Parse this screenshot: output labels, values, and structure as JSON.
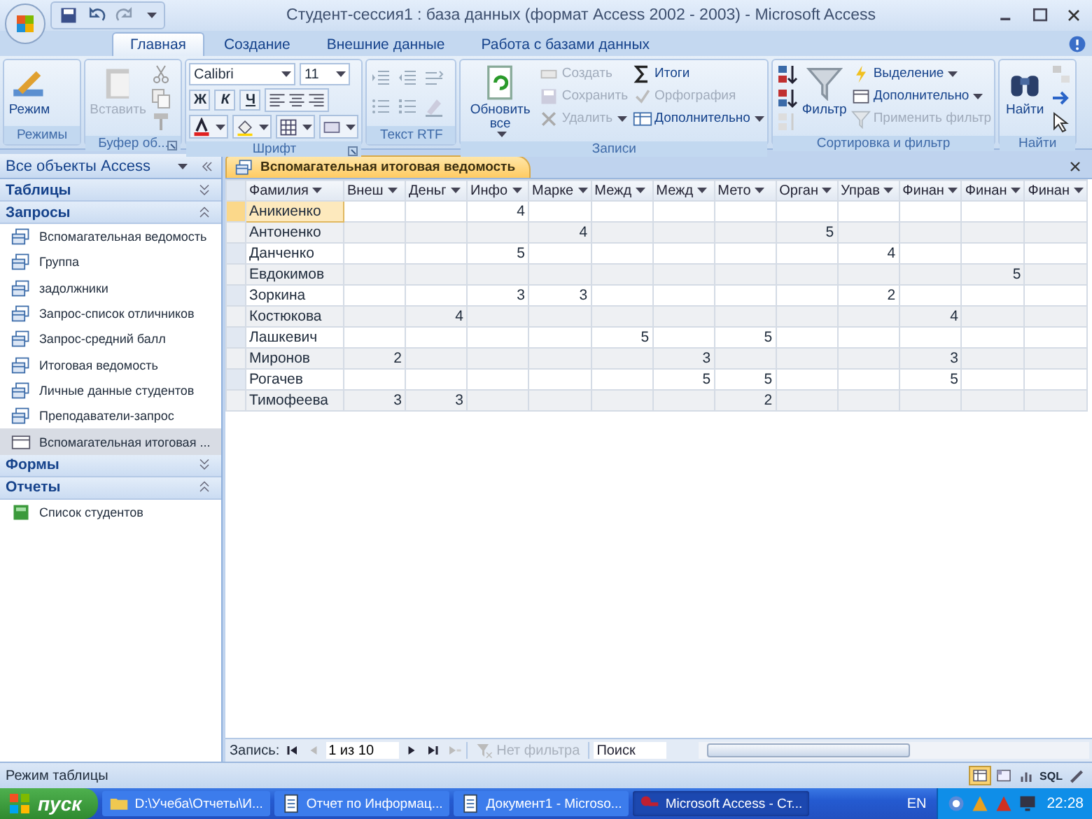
{
  "window": {
    "title": "Студент-сессия1 : база данных (формат Access 2002 - 2003) - Microsoft Access"
  },
  "ribbon_tabs": [
    {
      "label": "Главная",
      "selected": true
    },
    {
      "label": "Создание",
      "selected": false
    },
    {
      "label": "Внешние данные",
      "selected": false
    },
    {
      "label": "Работа с базами данных",
      "selected": false
    }
  ],
  "ribbon": [
    {
      "label": "Режимы",
      "launcher": false,
      "kind": "buttons",
      "large": [
        {
          "label": "Режим",
          "disabled": false,
          "dropdown": false
        }
      ]
    },
    {
      "label": "Буфер об...",
      "launcher": true,
      "kind": "buttons",
      "large": [
        {
          "label": "Вставить",
          "disabled": true,
          "dropdown": false
        }
      ]
    },
    {
      "label": "Шрифт",
      "launcher": true,
      "kind": "font",
      "font": "Calibri",
      "size": "11",
      "format_buttons": [
        "Ж",
        "К",
        "Ч"
      ]
    },
    {
      "label": "Текст RTF",
      "launcher": false,
      "kind": "buttons"
    },
    {
      "label": "Записи",
      "launcher": false,
      "kind": "buttons",
      "large": [
        {
          "label": "Обновить все",
          "disabled": false,
          "dropdown": true
        }
      ],
      "small": [
        {
          "label": "Создать",
          "disabled": true,
          "dropdown": false
        },
        {
          "label": "Сохранить",
          "disabled": true,
          "dropdown": false
        },
        {
          "label": "Удалить",
          "disabled": true,
          "dropdown": true
        },
        {
          "label": "Итоги",
          "disabled": false,
          "dropdown": false
        },
        {
          "label": "Орфография",
          "disabled": true,
          "dropdown": false
        },
        {
          "label": "Дополнительно",
          "disabled": false,
          "dropdown": true
        }
      ]
    },
    {
      "label": "Сортировка и фильтр",
      "launcher": false,
      "kind": "buttons",
      "large": [
        {
          "label": "Фильтр",
          "disabled": false,
          "dropdown": false
        }
      ],
      "small": [
        {
          "label": "Выделение",
          "disabled": false,
          "dropdown": true
        },
        {
          "label": "Дополнительно",
          "disabled": false,
          "dropdown": true
        },
        {
          "label": "Применить фильтр",
          "disabled": true,
          "dropdown": false
        }
      ]
    },
    {
      "label": "Найти",
      "launcher": false,
      "kind": "buttons",
      "large": [
        {
          "label": "Найти",
          "disabled": false,
          "dropdown": false
        }
      ]
    }
  ],
  "navigation_pane": {
    "title": "Все объекты Access",
    "sections": [
      {
        "label": "Таблицы",
        "expanded": false
      },
      {
        "label": "Запросы",
        "expanded": true,
        "items": [
          {
            "label": "Вспомагательная ведомость",
            "kind": "query",
            "selected": false
          },
          {
            "label": "Группа",
            "kind": "query",
            "selected": false
          },
          {
            "label": "задолжники",
            "kind": "query",
            "selected": false
          },
          {
            "label": "Запрос-список отличников",
            "kind": "query",
            "selected": false
          },
          {
            "label": "Запрос-средний балл",
            "kind": "query",
            "selected": false
          },
          {
            "label": "Итоговая ведомость",
            "kind": "query",
            "selected": false
          },
          {
            "label": "Личные данные студентов",
            "kind": "query",
            "selected": false
          },
          {
            "label": "Преподаватели-запрос",
            "kind": "query",
            "selected": false
          },
          {
            "label": "Вспомагательная итоговая ...",
            "kind": "datasheet",
            "selected": true
          }
        ]
      },
      {
        "label": "Формы",
        "expanded": false
      },
      {
        "label": "Отчеты",
        "expanded": true,
        "items": [
          {
            "label": "Список студентов",
            "kind": "report",
            "selected": false
          }
        ]
      }
    ]
  },
  "document_tab": {
    "title": "Вспомагательная итоговая ведомость"
  },
  "datasheet": {
    "columns": [
      "Фамилия",
      "Внеш",
      "Деньг",
      "Инфо",
      "Марке",
      "Межд",
      "Межд",
      "Мето",
      "Орган",
      "Управ",
      "Финан",
      "Финан",
      "Финан"
    ],
    "rows": [
      {
        "selected": true,
        "cells": [
          "Аникиенко",
          null,
          null,
          "4",
          null,
          null,
          null,
          null,
          null,
          null,
          null,
          null,
          null
        ]
      },
      {
        "selected": false,
        "cells": [
          "Антоненко",
          null,
          null,
          null,
          "4",
          null,
          null,
          null,
          "5",
          null,
          null,
          null,
          null
        ]
      },
      {
        "selected": false,
        "cells": [
          "Данченко",
          null,
          null,
          "5",
          null,
          null,
          null,
          null,
          null,
          "4",
          null,
          null,
          null
        ]
      },
      {
        "selected": false,
        "cells": [
          "Евдокимов",
          null,
          null,
          null,
          null,
          null,
          null,
          null,
          null,
          null,
          null,
          "5",
          null
        ]
      },
      {
        "selected": false,
        "cells": [
          "Зоркина",
          null,
          null,
          "3",
          "3",
          null,
          null,
          null,
          null,
          "2",
          null,
          null,
          null
        ]
      },
      {
        "selected": false,
        "cells": [
          "Костюкова",
          null,
          "4",
          null,
          null,
          null,
          null,
          null,
          null,
          null,
          "4",
          null,
          null
        ]
      },
      {
        "selected": false,
        "cells": [
          "Лашкевич",
          null,
          null,
          null,
          null,
          "5",
          null,
          "5",
          null,
          null,
          null,
          null,
          null
        ]
      },
      {
        "selected": false,
        "cells": [
          "Миронов",
          "2",
          null,
          null,
          null,
          null,
          "3",
          null,
          null,
          null,
          "3",
          null,
          null
        ]
      },
      {
        "selected": false,
        "cells": [
          "Рогачев",
          null,
          null,
          null,
          null,
          null,
          "5",
          "5",
          null,
          null,
          "5",
          null,
          null
        ]
      },
      {
        "selected": false,
        "cells": [
          "Тимофеева",
          "3",
          "3",
          null,
          null,
          null,
          null,
          "2",
          null,
          null,
          null,
          null,
          null
        ]
      }
    ]
  },
  "record_navigator": {
    "label": "Запись:",
    "position": "1 из 10",
    "filter": "Нет фильтра",
    "filter_disabled": true,
    "search_placeholder": "Поиск"
  },
  "status_bar": {
    "text": "Режим таблицы",
    "views": [
      {
        "selected": true
      },
      {
        "selected": false
      },
      {
        "selected": false
      },
      {
        "label": "SQL",
        "selected": false
      },
      {
        "selected": false
      }
    ]
  },
  "taskbar": {
    "start": "пуск",
    "tasks": [
      {
        "label": "D:\\Учеба\\Отчеты\\И...",
        "kind": "folder",
        "active": false
      },
      {
        "label": "Отчет по Информац...",
        "kind": "document",
        "active": false
      },
      {
        "label": "Документ1 - Microso...",
        "kind": "document",
        "active": false
      },
      {
        "label": "Microsoft Access - Ст...",
        "kind": "access",
        "active": true
      }
    ],
    "language": "EN",
    "clock": "22:28"
  }
}
